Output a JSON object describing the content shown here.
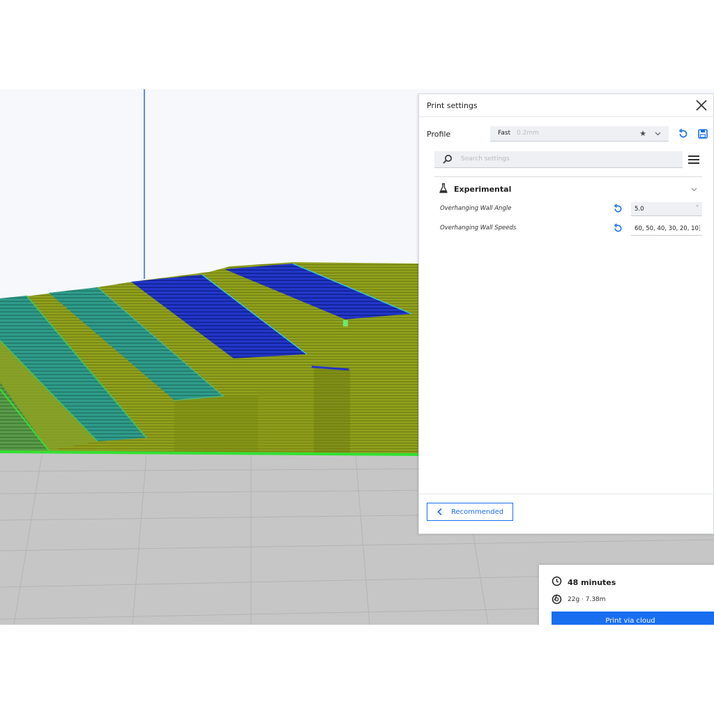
{
  "print_settings": {
    "title": "Print settings",
    "profile": {
      "label": "Profile",
      "name": "Fast",
      "layer_height": "0.2mm"
    },
    "search": {
      "placeholder": "Search settings",
      "value": ""
    },
    "section": {
      "title": "Experimental",
      "settings": [
        {
          "label": "Overhanging Wall Angle",
          "value": "5.0",
          "unit": "°"
        },
        {
          "label": "Overhanging Wall Speeds",
          "value": "60, 50, 40, 30, 20, 10]",
          "unit": ""
        }
      ]
    },
    "footer": {
      "recommended_label": "Recommended"
    }
  },
  "print_info": {
    "time": "48 minutes",
    "material": "22g · 7.38m",
    "print_button": "Print via cloud"
  },
  "colors": {
    "accent": "#196ef0",
    "model_olive": "#8a9a1a",
    "model_blue": "#1f36c8",
    "model_teal": "#2a9a7c",
    "outline_green": "#33e033",
    "build_plate": "#c9c9c9"
  }
}
